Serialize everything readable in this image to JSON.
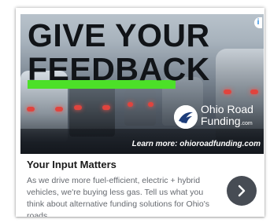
{
  "ad": {
    "headline_line1": "GIVE YOUR",
    "headline_line2": "FEEDBACK",
    "brand_name": "Ohio Road",
    "brand_name_line2": "Funding",
    "brand_suffix": ".com",
    "learn_more": "Learn more: ohioroadfunding.com",
    "title": "Your Input Matters",
    "body": "As we drive more fuel-efficient, electric + hybrid vehicles, we're buying less gas. Tell us what you think about alternative funding solutions for Ohio's roads.",
    "info_badge": "i",
    "next_icon": "chevron-right-icon"
  },
  "colors": {
    "highlight": "#4ce028",
    "next_button": "#474c54",
    "headline": "#111418",
    "body_text": "#666a70"
  }
}
